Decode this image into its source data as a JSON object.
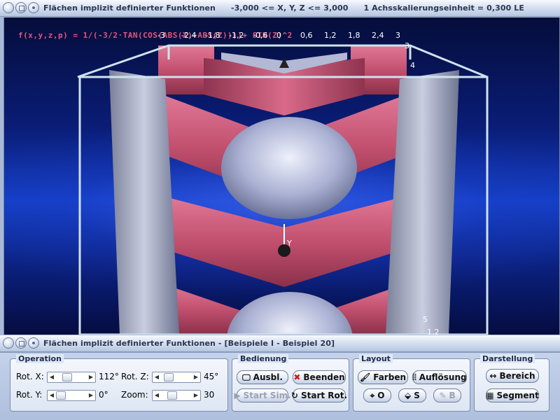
{
  "top_window": {
    "title": "Flächen implizit definierter Funktionen",
    "range": "-3,000 <= X, Y, Z <= 3,000",
    "scale": "1 Achsskalierungseinheit = 0,300 LE"
  },
  "viewport": {
    "formula": "f(x,y,z,p) = 1/(-3/2·TAN(COS(ABS(X)+ABS(Z))))+ SIN(Z)^2",
    "ticks_top": [
      "-3",
      "-2,4",
      "-1,8",
      "-1,2",
      "-0,6",
      "0",
      "0,6",
      "1,2",
      "1,8",
      "2,4",
      "3"
    ],
    "tick_right": [
      "3",
      "4"
    ],
    "tick_bottom_right": [
      "5",
      "1,2"
    ],
    "axis_y_label": "Y",
    "colors": {
      "surface": "#c2506f",
      "sphere": "#b8bfe0",
      "box": "#c8dbe8"
    }
  },
  "bottom_window": {
    "title": "Flächen implizit definierter Funktionen - [Beispiele I - Beispiel 20]"
  },
  "operation": {
    "title": "Operation",
    "rot_x": {
      "label": "Rot. X:",
      "value": "112°",
      "level": 0.31
    },
    "rot_y": {
      "label": "Rot. Y:",
      "value": "0°",
      "level": 0.0
    },
    "rot_z": {
      "label": "Rot. Z:",
      "value": "45°",
      "level": 0.125
    },
    "zoom": {
      "label": "Zoom:",
      "value": "30",
      "level": 0.3
    }
  },
  "bedienung": {
    "title": "Bedienung",
    "ausbl": "Ausbl.",
    "beenden": "Beenden",
    "start_sim": "Start Sim.",
    "start_rot": "Start Rot."
  },
  "layout": {
    "title": "Layout",
    "farben": "Farben",
    "aufloesung": "Auflösung",
    "o": "O",
    "s": "S",
    "b": "B"
  },
  "darstellung": {
    "title": "Darstellung",
    "bereich": "Bereich",
    "segment": "Segment"
  }
}
